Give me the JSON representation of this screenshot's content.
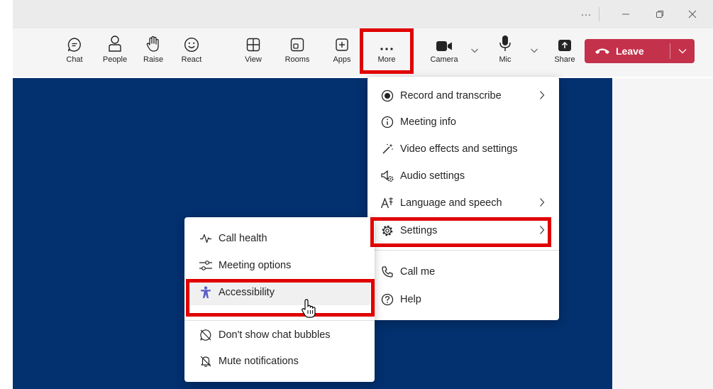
{
  "toolbar": {
    "chat": "Chat",
    "people": "People",
    "raise": "Raise",
    "react": "React",
    "view": "View",
    "rooms": "Rooms",
    "apps": "Apps",
    "more": "More",
    "camera": "Camera",
    "mic": "Mic",
    "share": "Share",
    "leave": "Leave"
  },
  "more_menu": {
    "items": [
      {
        "label": "Record and transcribe",
        "icon": "record-icon",
        "submenu": true
      },
      {
        "label": "Meeting info",
        "icon": "info-icon",
        "submenu": false
      },
      {
        "label": "Video effects and settings",
        "icon": "magic-wand-icon",
        "submenu": false
      },
      {
        "label": "Audio settings",
        "icon": "speaker-gear-icon",
        "submenu": false
      },
      {
        "label": "Language and speech",
        "icon": "language-icon",
        "submenu": true
      },
      {
        "label": "Settings",
        "icon": "gear-icon",
        "submenu": true
      },
      {
        "label": "Call me",
        "icon": "phone-icon",
        "submenu": false
      },
      {
        "label": "Help",
        "icon": "help-icon",
        "submenu": false
      }
    ]
  },
  "settings_submenu": {
    "items": [
      {
        "label": "Call health",
        "icon": "pulse-icon"
      },
      {
        "label": "Meeting options",
        "icon": "sliders-icon"
      },
      {
        "label": "Accessibility",
        "icon": "accessibility-icon"
      },
      {
        "label": "Don't show chat bubbles",
        "icon": "chat-off-icon"
      },
      {
        "label": "Mute notifications",
        "icon": "bell-off-icon"
      }
    ]
  },
  "colors": {
    "leave": "#c4314b",
    "stage": "#03306e",
    "highlight": "#e00000",
    "accessibility_icon": "#5b5fc7"
  }
}
